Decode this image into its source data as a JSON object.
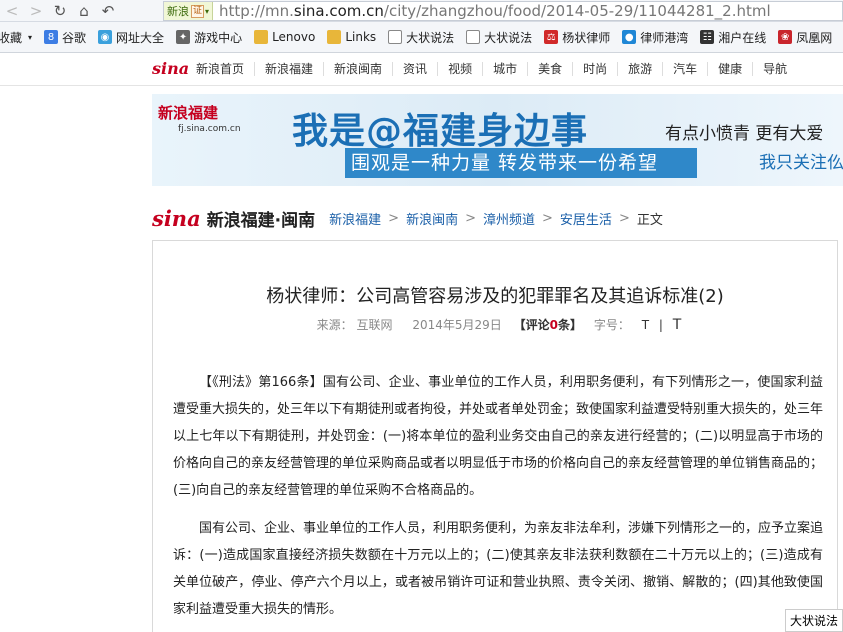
{
  "browser": {
    "site_tag": "新浪",
    "cert_badge": "证",
    "url_prefix": "http://mn.",
    "url_domain": "sina.com.cn",
    "url_path": "/city/zhangzhou/food/2014-05-29/11044281_2.html"
  },
  "favorites": {
    "label": "收藏",
    "items": [
      "谷歌",
      "网址大全",
      "游戏中心",
      "Lenovo",
      "Links",
      "大状说法",
      "大状说法",
      "杨状律师",
      "律师港湾",
      "湘户在线",
      "凤凰网"
    ]
  },
  "sina_nav": {
    "logo": "sina",
    "items": [
      "新浪首页",
      "新浪福建",
      "新浪闽南",
      "资讯",
      "视频",
      "城市",
      "美食",
      "时尚",
      "旅游",
      "汽车",
      "健康",
      "导航"
    ]
  },
  "banner": {
    "logo": "新浪福建",
    "logo_sub": "fj.sina.com.cn",
    "headline": "我是@福建身边事",
    "sub": "围观是一种力量  转发带来一份希望",
    "right_line1": "有点小愤青 更有大爱",
    "right_line2": "我只关注仫"
  },
  "breadcrumb": {
    "logo": "sina",
    "site": "新浪福建·闽南",
    "items": [
      "新浪福建",
      "新浪闽南",
      "漳州频道",
      "安居生活"
    ],
    "current": "正文",
    "separator": ">"
  },
  "article": {
    "title": "杨状律师：公司高管容易涉及的犯罪罪名及其追诉标准(2)",
    "source_label": "来源：",
    "source": "互联网",
    "date": "2014年5月29日",
    "comment_open": "【评论",
    "comment_count": "0",
    "comment_close": "条】",
    "font_label": "字号：",
    "font_small": "T",
    "font_sep": "|",
    "font_large": "T",
    "paragraphs": [
      "【《刑法》第166条】国有公司、企业、事业单位的工作人员，利用职务便利，有下列情形之一，使国家利益遭受重大损失的，处三年以下有期徒刑或者拘役，并处或者单处罚金；致使国家利益遭受特别重大损失的，处三年以上七年以下有期徒刑，并处罚金：(一)将本单位的盈利业务交由自己的亲友进行经营的；(二)以明显高于市场的价格向自己的亲友经营管理的单位采购商品或者以明显低于市场的价格向自己的亲友经营管理的单位销售商品的；(三)向自己的亲友经营管理的单位采购不合格商品的。",
      "国有公司、企业、事业单位的工作人员，利用职务便利，为亲友非法牟利，涉嫌下列情形之一的，应予立案追诉：(一)造成国家直接经济损失数额在十万元以上的；(二)使其亲友非法获利数额在二十万元以上的；(三)造成有关单位破产，停业、停产六个月以上，或者被吊销许可证和营业执照、责令关闭、撤销、解散的；(四)其他致使国家利益遭受重大损失的情形。"
    ]
  },
  "corner_tip": "大状说法"
}
